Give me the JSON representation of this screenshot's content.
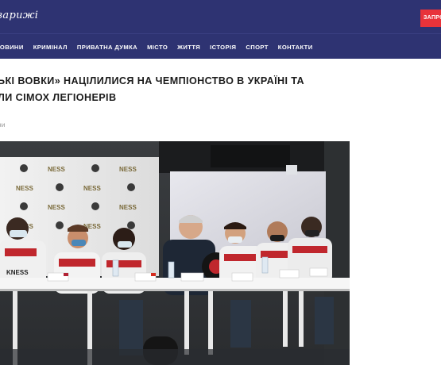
{
  "header": {
    "logo_text": "зарижі",
    "cta_label": "ЗАПРО"
  },
  "nav": {
    "items": [
      "НОВИНИ",
      "КРИМІНАЛ",
      "ПРИВАТНА ДУМКА",
      "МІСТО",
      "ЖИТТЯ",
      "ІСТОРІЯ",
      "СПОРТ",
      "КОНТАКТИ"
    ]
  },
  "article": {
    "title_line1": "ЬКІ ВОВКИ» НАЦІЛИЛИСЯ НА ЧЕМПІОНСТВО В УКРАЇНІ ТА",
    "title_line2": "ЛИ СІМОХ ЛЕГІОНЕРІВ",
    "meta": "ни",
    "backdrop_text": "NESS",
    "jersey_text": "KNESS",
    "photo_subject": "press-conference-photo"
  },
  "colors": {
    "brand_navy": "#2e3372",
    "cta_red": "#e8333a",
    "jersey_red": "#c0272d"
  }
}
